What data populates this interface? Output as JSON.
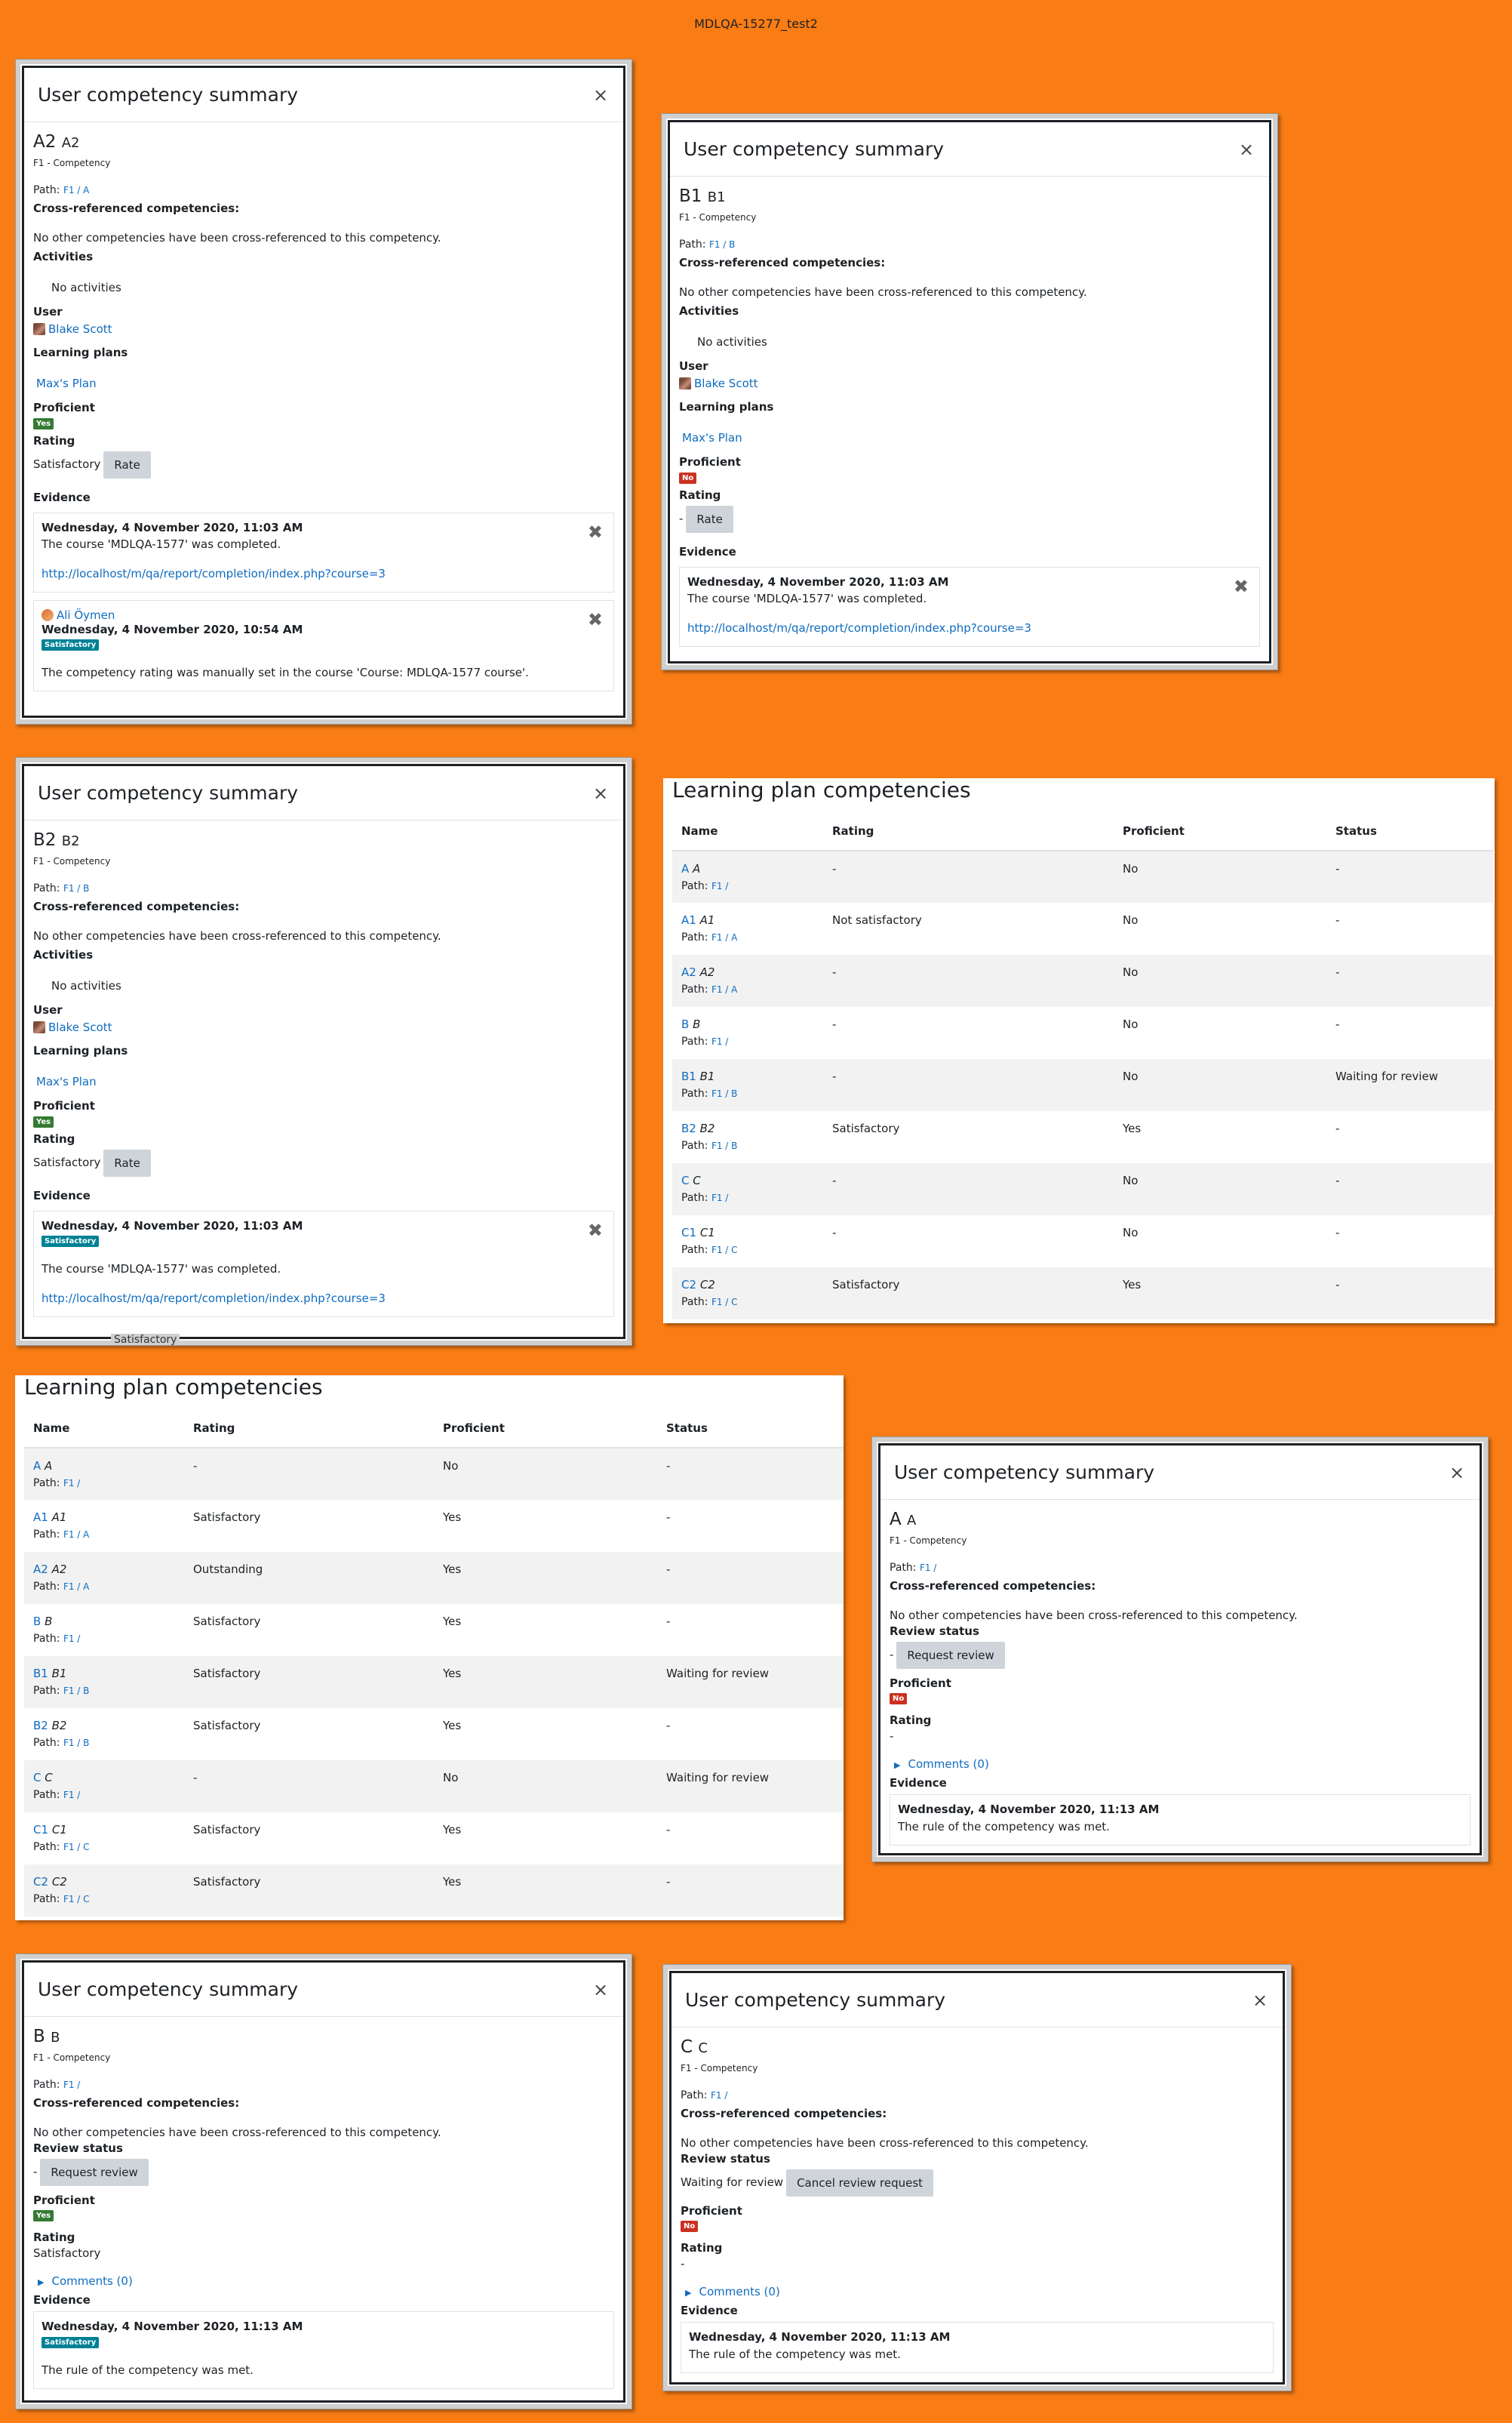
{
  "page_title": "MDLQA-15277_test2",
  "modals": [
    {
      "title": "User competency summary",
      "code": "A2",
      "name": "A2",
      "framework": "F1 - Competency",
      "path_label": "Path:",
      "path": "F1 / A",
      "cross_label": "Cross-referenced competencies:",
      "cross_text": "No other competencies have been cross-referenced to this competency.",
      "activities_label": "Activities",
      "activities_text": "No activities",
      "user_label": "User",
      "user_name": "Blake Scott",
      "plans_label": "Learning plans",
      "plan_name": "Max's Plan",
      "proficient_label": "Proficient",
      "proficient_badge": "Yes",
      "rating_label": "Rating",
      "rating_value": "Satisfactory",
      "rate_button": "Rate",
      "evidence_label": "Evidence",
      "evidence": [
        {
          "date": "Wednesday, 4 November 2020, 11:03 AM",
          "text": "The course 'MDLQA-1577' was completed.",
          "link": "http://localhost/m/qa/report/completion/index.php?course=3"
        },
        {
          "author": "Ali Öymen",
          "date": "Wednesday, 4 November 2020, 10:54 AM",
          "badge": "Satisfactory",
          "text": "The competency rating was manually set in the course 'Course: MDLQA-1577 course'."
        }
      ]
    },
    {
      "title": "User competency summary",
      "code": "B1",
      "name": "B1",
      "framework": "F1 - Competency",
      "path_label": "Path:",
      "path": "F1 / B",
      "cross_label": "Cross-referenced competencies:",
      "cross_text": "No other competencies have been cross-referenced to this competency.",
      "activities_label": "Activities",
      "activities_text": "No activities",
      "user_label": "User",
      "user_name": "Blake Scott",
      "plans_label": "Learning plans",
      "plan_name": "Max's Plan",
      "proficient_label": "Proficient",
      "proficient_badge": "No",
      "rating_label": "Rating",
      "rating_value": "-",
      "rate_button": "Rate",
      "evidence_label": "Evidence",
      "evidence": [
        {
          "date": "Wednesday, 4 November 2020, 11:03 AM",
          "text": "The course 'MDLQA-1577' was completed.",
          "link": "http://localhost/m/qa/report/completion/index.php?course=3"
        }
      ]
    },
    {
      "title": "User competency summary",
      "code": "B2",
      "name": "B2",
      "framework": "F1 - Competency",
      "path_label": "Path:",
      "path": "F1 / B",
      "cross_label": "Cross-referenced competencies:",
      "cross_text": "No other competencies have been cross-referenced to this competency.",
      "activities_label": "Activities",
      "activities_text": "No activities",
      "user_label": "User",
      "user_name": "Blake Scott",
      "plans_label": "Learning plans",
      "plan_name": "Max's Plan",
      "proficient_label": "Proficient",
      "proficient_badge": "Yes",
      "rating_label": "Rating",
      "rating_value": "Satisfactory",
      "rate_button": "Rate",
      "evidence_label": "Evidence",
      "evidence": [
        {
          "date": "Wednesday, 4 November 2020, 11:03 AM",
          "badge": "Satisfactory",
          "text": "The course 'MDLQA-1577' was completed.",
          "link": "http://localhost/m/qa/report/completion/index.php?course=3"
        }
      ],
      "behind_text": "Satisfactory"
    },
    {
      "title": "User competency summary",
      "code": "A",
      "name": "A",
      "framework": "F1 - Competency",
      "path_label": "Path:",
      "path": "F1 /",
      "cross_label": "Cross-referenced competencies:",
      "cross_text": "No other competencies have been cross-referenced to this competency.",
      "review_label": "Review status",
      "review_value": "-",
      "review_button": "Request review",
      "proficient_label": "Proficient",
      "proficient_badge": "No",
      "rating_label": "Rating",
      "rating_value": "-",
      "comments": "Comments (0)",
      "evidence_label": "Evidence",
      "evidence": [
        {
          "date": "Wednesday, 4 November 2020, 11:13 AM",
          "text": "The rule of the competency was met."
        }
      ]
    },
    {
      "title": "User competency summary",
      "code": "B",
      "name": "B",
      "framework": "F1 - Competency",
      "path_label": "Path:",
      "path": "F1 /",
      "cross_label": "Cross-referenced competencies:",
      "cross_text": "No other competencies have been cross-referenced to this competency.",
      "review_label": "Review status",
      "review_value": "-",
      "review_button": "Request review",
      "proficient_label": "Proficient",
      "proficient_badge": "Yes",
      "rating_label": "Rating",
      "rating_value": "Satisfactory",
      "comments": "Comments (0)",
      "evidence_label": "Evidence",
      "evidence": [
        {
          "date": "Wednesday, 4 November 2020, 11:13 AM",
          "badge": "Satisfactory",
          "text": "The rule of the competency was met."
        }
      ]
    },
    {
      "title": "User competency summary",
      "code": "C",
      "name": "C",
      "framework": "F1 - Competency",
      "path_label": "Path:",
      "path": "F1 /",
      "cross_label": "Cross-referenced competencies:",
      "cross_text": "No other competencies have been cross-referenced to this competency.",
      "review_label": "Review status",
      "review_value": "Waiting for review",
      "review_button": "Cancel review request",
      "proficient_label": "Proficient",
      "proficient_badge": "No",
      "rating_label": "Rating",
      "rating_value": "-",
      "comments": "Comments (0)",
      "evidence_label": "Evidence",
      "evidence": [
        {
          "date": "Wednesday, 4 November 2020, 11:13 AM",
          "text": "The rule of the competency was met."
        }
      ]
    }
  ],
  "tables": [
    {
      "title": "Learning plan competencies",
      "headers": [
        "Name",
        "Rating",
        "Proficient",
        "Status"
      ],
      "path_label": "Path:",
      "rows": [
        {
          "code": "A",
          "name": "A",
          "path": "F1 /",
          "rating": "-",
          "proficient": "No",
          "status": "-"
        },
        {
          "code": "A1",
          "name": "A1",
          "path": "F1 / A",
          "rating": "Not satisfactory",
          "proficient": "No",
          "status": "-"
        },
        {
          "code": "A2",
          "name": "A2",
          "path": "F1 / A",
          "rating": "-",
          "proficient": "No",
          "status": "-"
        },
        {
          "code": "B",
          "name": "B",
          "path": "F1 /",
          "rating": "-",
          "proficient": "No",
          "status": "-"
        },
        {
          "code": "B1",
          "name": "B1",
          "path": "F1 / B",
          "rating": "-",
          "proficient": "No",
          "status": "Waiting for review"
        },
        {
          "code": "B2",
          "name": "B2",
          "path": "F1 / B",
          "rating": "Satisfactory",
          "proficient": "Yes",
          "status": "-"
        },
        {
          "code": "C",
          "name": "C",
          "path": "F1 /",
          "rating": "-",
          "proficient": "No",
          "status": "-"
        },
        {
          "code": "C1",
          "name": "C1",
          "path": "F1 / C",
          "rating": "-",
          "proficient": "No",
          "status": "-"
        },
        {
          "code": "C2",
          "name": "C2",
          "path": "F1 / C",
          "rating": "Satisfactory",
          "proficient": "Yes",
          "status": "-"
        }
      ]
    },
    {
      "title": "Learning plan competencies",
      "headers": [
        "Name",
        "Rating",
        "Proficient",
        "Status"
      ],
      "path_label": "Path:",
      "rows": [
        {
          "code": "A",
          "name": "A",
          "path": "F1 /",
          "rating": "-",
          "proficient": "No",
          "status": "-"
        },
        {
          "code": "A1",
          "name": "A1",
          "path": "F1 / A",
          "rating": "Satisfactory",
          "proficient": "Yes",
          "status": "-"
        },
        {
          "code": "A2",
          "name": "A2",
          "path": "F1 / A",
          "rating": "Outstanding",
          "proficient": "Yes",
          "status": "-"
        },
        {
          "code": "B",
          "name": "B",
          "path": "F1 /",
          "rating": "Satisfactory",
          "proficient": "Yes",
          "status": "-"
        },
        {
          "code": "B1",
          "name": "B1",
          "path": "F1 / B",
          "rating": "Satisfactory",
          "proficient": "Yes",
          "status": "Waiting for review"
        },
        {
          "code": "B2",
          "name": "B2",
          "path": "F1 / B",
          "rating": "Satisfactory",
          "proficient": "Yes",
          "status": "-"
        },
        {
          "code": "C",
          "name": "C",
          "path": "F1 /",
          "rating": "-",
          "proficient": "No",
          "status": "Waiting for review"
        },
        {
          "code": "C1",
          "name": "C1",
          "path": "F1 / C",
          "rating": "Satisfactory",
          "proficient": "Yes",
          "status": "-"
        },
        {
          "code": "C2",
          "name": "C2",
          "path": "F1 / C",
          "rating": "Satisfactory",
          "proficient": "Yes",
          "status": "-"
        }
      ]
    }
  ],
  "colors": {
    "background": "#f97c14",
    "link": "#0f6cbf",
    "badge_yes": "#357a32",
    "badge_no": "#ca3120",
    "badge_satisfactory": "#008196",
    "button": "#ced4da"
  }
}
